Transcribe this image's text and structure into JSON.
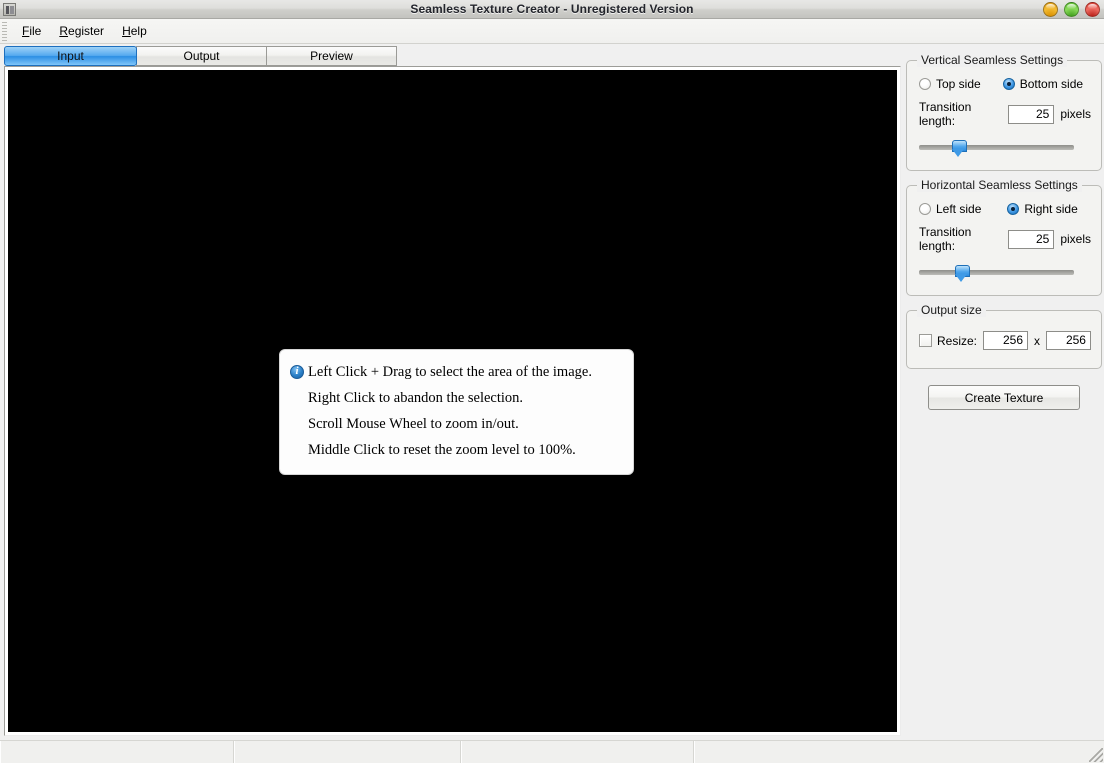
{
  "window": {
    "title": "Seamless Texture Creator - Unregistered Version",
    "app_icon": "application-icon",
    "buttons": {
      "minimize": "minimize-button",
      "maximize": "maximize-button",
      "close": "close-button"
    }
  },
  "menubar": {
    "items": [
      {
        "label": "File",
        "accel": "F"
      },
      {
        "label": "Register",
        "accel": "R"
      },
      {
        "label": "Help",
        "accel": "H"
      }
    ]
  },
  "tabs": {
    "active": "Input",
    "items": [
      {
        "label": "Input",
        "selected": true
      },
      {
        "label": "Output",
        "selected": false
      },
      {
        "label": "Preview",
        "selected": false
      }
    ]
  },
  "canvas": {
    "background_color": "#000000",
    "hint": {
      "icon": "info-icon",
      "lines": [
        "Left Click + Drag to select the area of the image.",
        "Right Click to abandon the selection.",
        "Scroll Mouse Wheel to zoom in/out.",
        "Middle Click to reset the zoom level to 100%."
      ]
    }
  },
  "vertical_seamless": {
    "title": "Vertical Seamless Settings",
    "radio_top": {
      "label": "Top side",
      "checked": false
    },
    "radio_bottom": {
      "label": "Bottom side",
      "checked": true
    },
    "transition_label": "Transition length:",
    "transition_value": "25",
    "unit": "pixels",
    "slider_percent": 25
  },
  "horizontal_seamless": {
    "title": "Horizontal Seamless Settings",
    "radio_left": {
      "label": "Left side",
      "checked": false
    },
    "radio_right": {
      "label": "Right side",
      "checked": true
    },
    "transition_label": "Transition length:",
    "transition_value": "25",
    "unit": "pixels",
    "slider_percent": 25
  },
  "output_size": {
    "title": "Output size",
    "resize_label": "Resize:",
    "resize_checked": false,
    "width": "256",
    "separator": "x",
    "height": "256"
  },
  "actions": {
    "create_texture": "Create Texture"
  },
  "statusbar": {
    "cells": [
      "",
      "",
      "",
      ""
    ],
    "grip": "resize-grip"
  },
  "colors": {
    "accent_blue": "#2b8ede",
    "panel_bg": "#f0f0f0",
    "canvas_bg": "#000000",
    "title_text": "#23252c"
  }
}
